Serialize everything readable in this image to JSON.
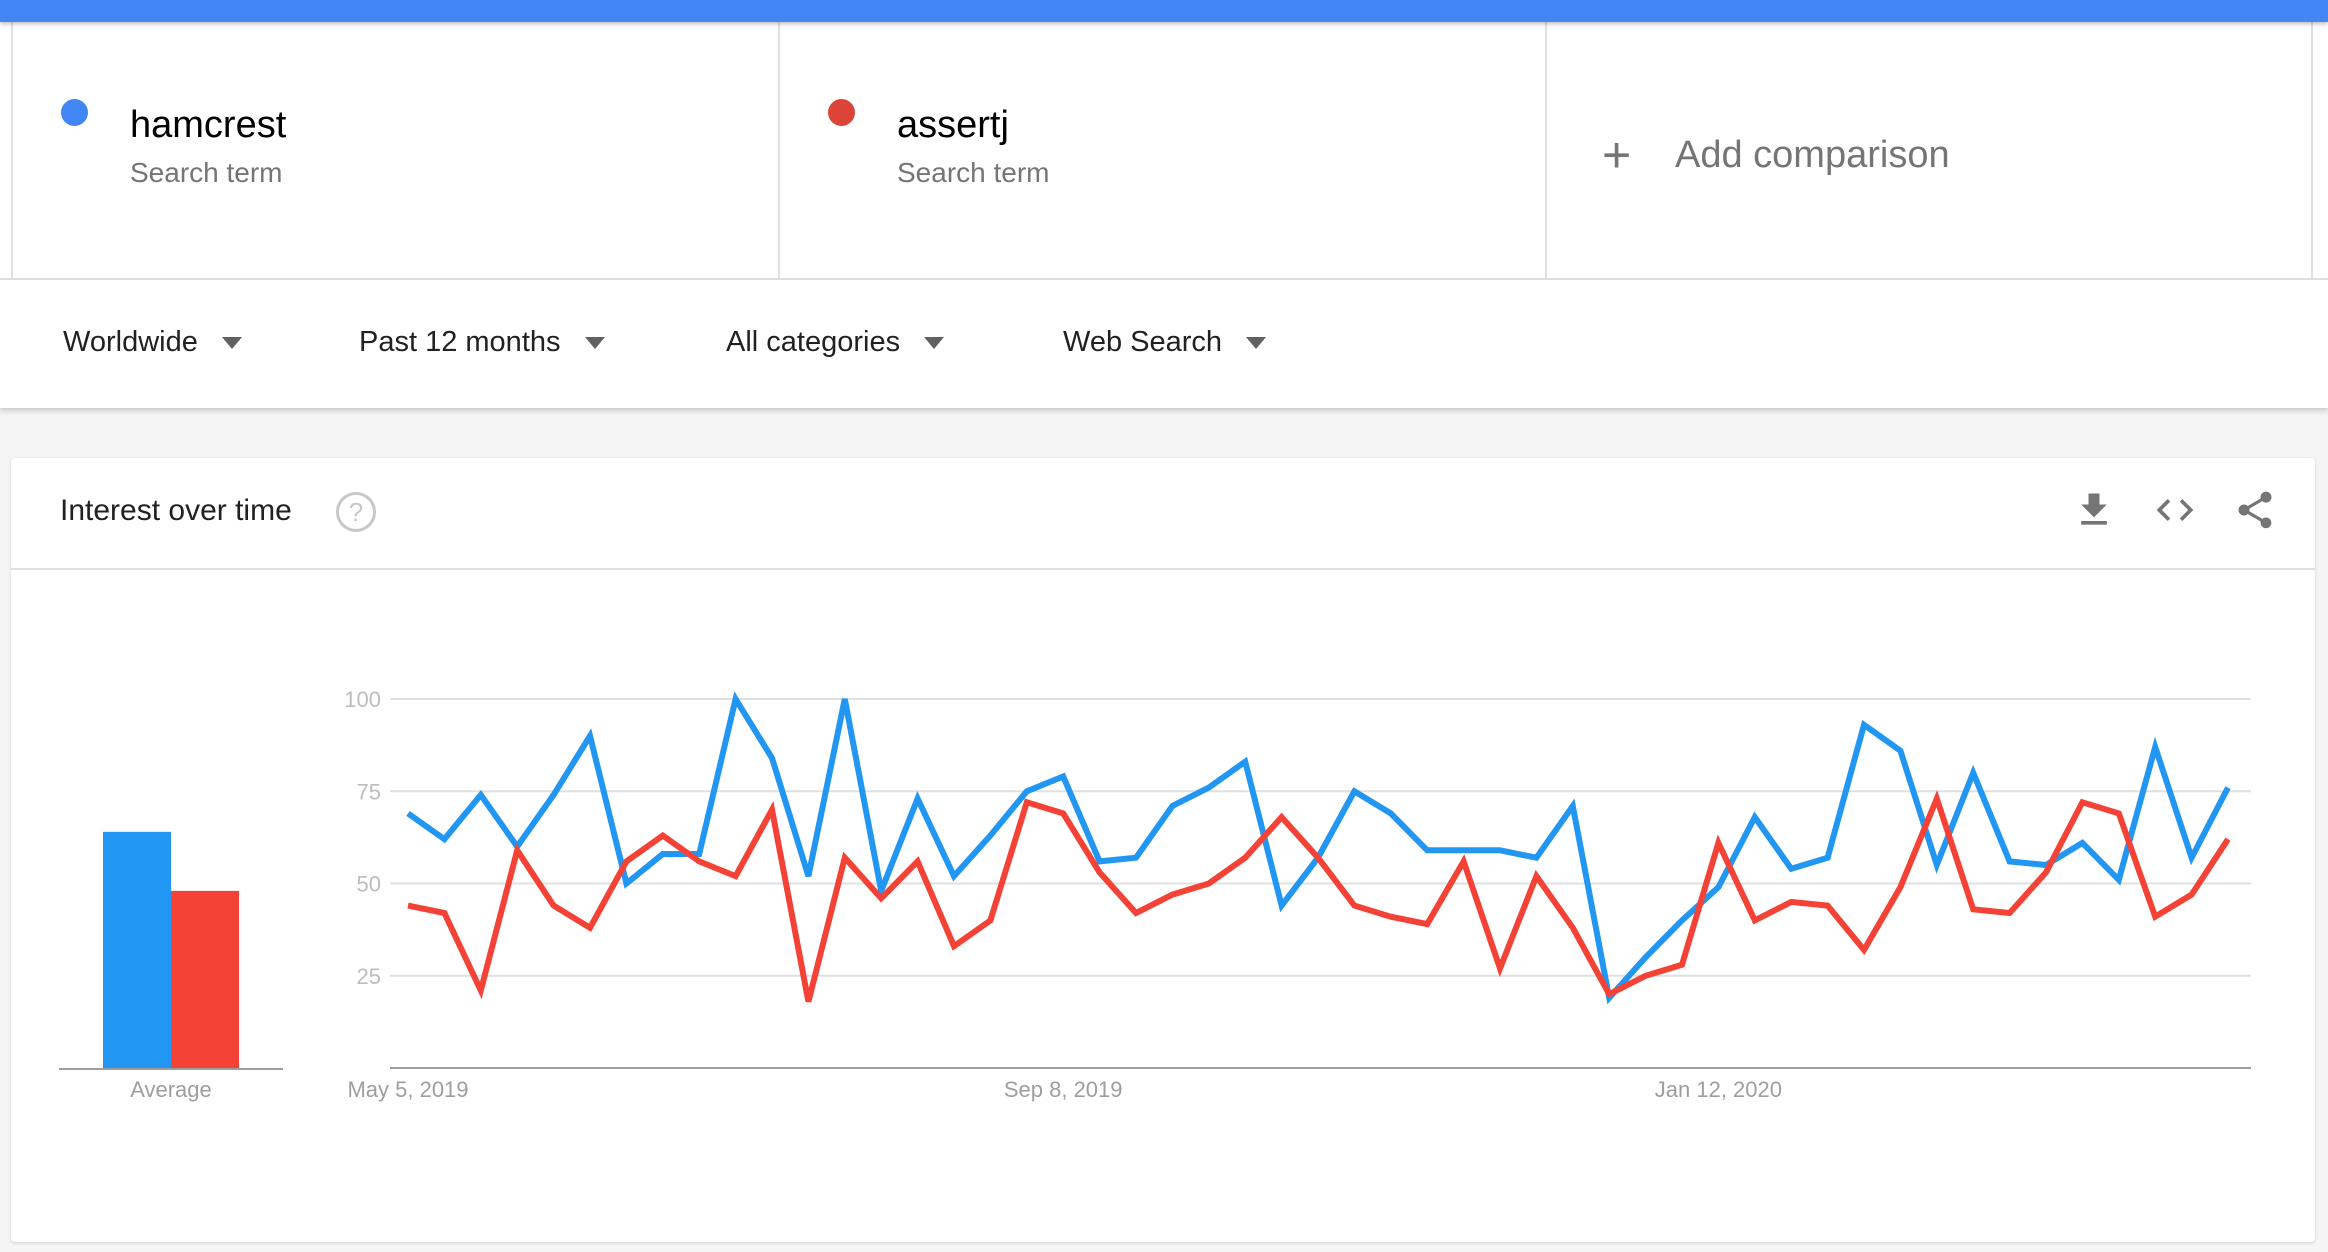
{
  "colors": {
    "topbar": "#4285f4",
    "term1_dot": "#4285f4",
    "term2_dot": "#db4437",
    "series1": "#2196f3",
    "series2": "#f44336",
    "gridline": "#e0e0e0",
    "axis": "#9e9e9e",
    "tick_text": "#9e9e9e",
    "icon": "#757575"
  },
  "terms": [
    {
      "name": "hamcrest",
      "subtitle": "Search term"
    },
    {
      "name": "assertj",
      "subtitle": "Search term"
    }
  ],
  "add_comparison": {
    "icon": "plus-icon",
    "label": "Add comparison"
  },
  "filters": [
    {
      "label": "Worldwide",
      "icon": "caret-down-icon"
    },
    {
      "label": "Past 12 months",
      "icon": "caret-down-icon"
    },
    {
      "label": "All categories",
      "icon": "caret-down-icon"
    },
    {
      "label": "Web Search",
      "icon": "caret-down-icon"
    }
  ],
  "card": {
    "title": "Interest over time",
    "help_icon": "?",
    "actions": [
      "download-icon",
      "embed-code-icon",
      "share-icon"
    ]
  },
  "chart_data": {
    "type": "line",
    "title": "Interest over time",
    "xlabel": "",
    "ylabel": "",
    "ylim": [
      0,
      100
    ],
    "yticks": [
      25,
      50,
      75,
      100
    ],
    "grid": true,
    "x_tick_labels": [
      {
        "index": 0,
        "label": "May 5, 2019"
      },
      {
        "index": 18,
        "label": "Sep 8, 2019"
      },
      {
        "index": 36,
        "label": "Jan 12, 2020"
      }
    ],
    "average": {
      "label": "Average",
      "values": [
        64,
        48
      ]
    },
    "series": [
      {
        "name": "hamcrest",
        "values": [
          69,
          62,
          74,
          60,
          74,
          90,
          50,
          58,
          58,
          100,
          84,
          52,
          100,
          48,
          73,
          52,
          63,
          75,
          79,
          56,
          57,
          71,
          76,
          83,
          44,
          57,
          75,
          69,
          59,
          59,
          59,
          57,
          71,
          19,
          30,
          40,
          49,
          68,
          54,
          57,
          93,
          86,
          55,
          80,
          56,
          55,
          61,
          51,
          87,
          57,
          76
        ]
      },
      {
        "name": "assertj",
        "values": [
          44,
          42,
          21,
          59,
          44,
          38,
          56,
          63,
          56,
          52,
          70,
          18,
          57,
          46,
          56,
          33,
          40,
          72,
          69,
          53,
          42,
          47,
          50,
          57,
          68,
          57,
          44,
          41,
          39,
          56,
          27,
          52,
          38,
          20,
          25,
          28,
          61,
          40,
          45,
          44,
          32,
          49,
          73,
          43,
          42,
          53,
          72,
          69,
          41,
          47,
          62
        ]
      }
    ]
  }
}
